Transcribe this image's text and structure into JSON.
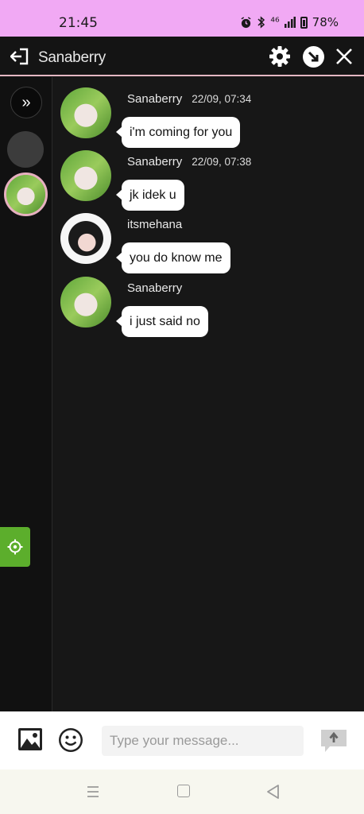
{
  "status_bar": {
    "time": "21:45",
    "network": "⁴⁶",
    "battery": "78%",
    "icons": [
      "alarm-icon",
      "bluetooth-icon",
      "signal-icon",
      "battery-icon"
    ]
  },
  "header": {
    "title": "Sanaberry",
    "icons": [
      "exit-icon",
      "gear-icon",
      "minimize-icon",
      "close-icon"
    ]
  },
  "sidebar": {
    "expand_glyph": "»",
    "icons": [
      "expand-icon",
      "settings-icon"
    ]
  },
  "messages": [
    {
      "sender": "Sanaberry",
      "time": "22/09, 07:34",
      "text": "i'm coming for you",
      "avatar": "boy"
    },
    {
      "sender": "Sanaberry",
      "time": "22/09, 07:38",
      "text": "jk idek u",
      "avatar": "boy"
    },
    {
      "sender": "itsmehana",
      "time": "",
      "text": "you do know me",
      "avatar": "girl"
    },
    {
      "sender": "Sanaberry",
      "time": "",
      "text": "i just said no",
      "avatar": "boy"
    }
  ],
  "composer": {
    "placeholder": "Type your message...",
    "icons": [
      "image-icon",
      "emoji-icon",
      "send-icon"
    ]
  },
  "colors": {
    "status_bar": "#f1a9f4",
    "header_border": "#e4b7c3",
    "accent_green": "#5cae2c",
    "background": "#171717"
  }
}
